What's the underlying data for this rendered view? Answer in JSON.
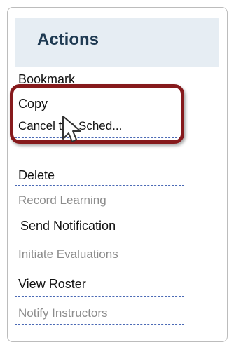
{
  "panel": {
    "title": "Actions"
  },
  "menu": {
    "items": [
      {
        "label": "Bookmark",
        "enabled": true
      },
      {
        "label": "Copy",
        "enabled": true
      },
      {
        "label": "Cancel the Sched...",
        "enabled": true
      },
      {
        "label": "Delete",
        "enabled": true
      },
      {
        "label": "Record Learning",
        "enabled": false
      },
      {
        "label": "Send Notification",
        "enabled": true
      },
      {
        "label": "Initiate Evaluations",
        "enabled": false
      },
      {
        "label": "View Roster",
        "enabled": true
      },
      {
        "label": "Notify Instructors",
        "enabled": false
      }
    ]
  },
  "colors": {
    "header_bg": "#e6edf3",
    "title": "#1f3a52",
    "divider": "#4a69b5",
    "disabled_text": "#8c8c8c",
    "highlight": "#861a1c"
  },
  "icons": {
    "cursor": "mouse-pointer-icon"
  }
}
